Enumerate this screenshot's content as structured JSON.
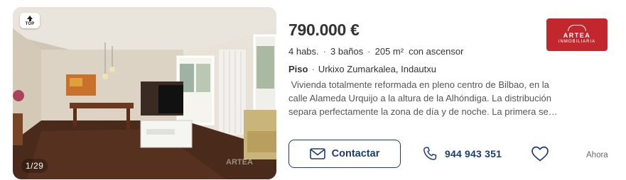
{
  "listing": {
    "badge": "TOP",
    "photo_counter": "1/29",
    "watermark": "ARTEA",
    "price": "790.000 €",
    "features": [
      "4 habs.",
      "3 baños",
      "205 m²"
    ],
    "features_extra": "con ascensor",
    "property_type": "Piso",
    "address": "Urkixo Zumarkalea, Indautxu",
    "description": " Vivienda totalmente reformada en pleno centro de Bilbao, en la calle Alameda Urquijo a la altura de la Alhóndiga. La distribución separa perfectamente la zona de día y de noche. La primera se…",
    "agency": {
      "name": "ARTEA",
      "subtitle": "INMOBILIARIA",
      "color": "#c1272d"
    },
    "contact_label": "Contactar",
    "phone": "944 943 351",
    "time_ago": "Ahora"
  },
  "icons": {
    "contact": "envelope-icon",
    "phone": "phone-icon",
    "favorite": "heart-outline-icon",
    "badge": "arrow-up-icon"
  },
  "colors": {
    "accent": "#1d3b71",
    "text": "#333333",
    "muted": "#666666"
  }
}
